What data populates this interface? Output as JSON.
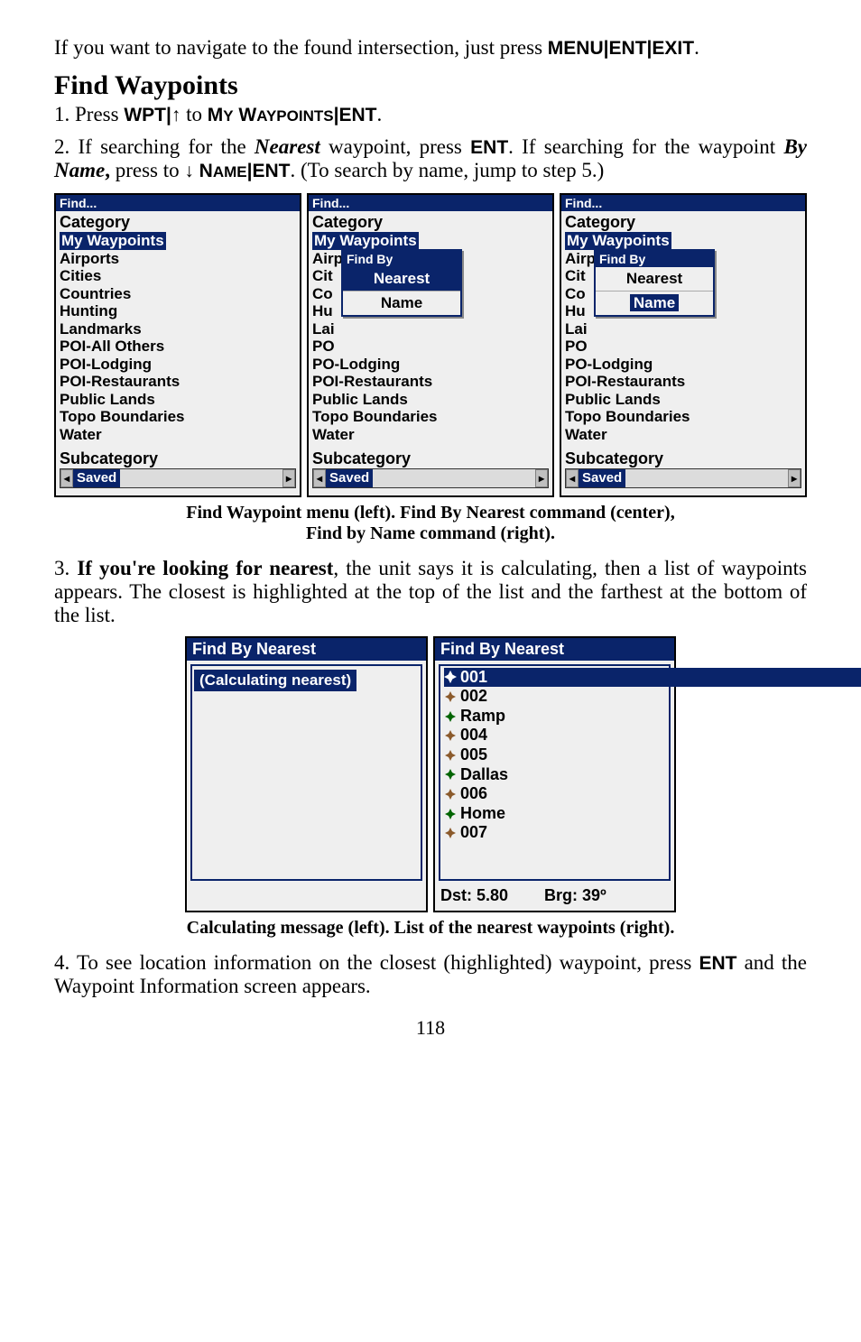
{
  "intro": {
    "text_before": "If you want to navigate to the found intersection, just press ",
    "menu": "MENU",
    "ent": "ENT",
    "exit": "EXIT",
    "period": "."
  },
  "h2": "Find Waypoints",
  "step1": {
    "prefix": "1. Press ",
    "wpt": "WPT",
    "to": " to ",
    "my_w": "M",
    "my_y": "Y",
    "waypoints_w": " W",
    "waypoints_rest": "AYPOINTS",
    "ent": "ENT",
    "period": "."
  },
  "step2": {
    "line_a": "2. If searching for the ",
    "nearest": "Nearest",
    "line_b": " waypoint, press ",
    "ent1": "ENT",
    "line_c": ". If searching for the waypoint ",
    "byname": "By Name",
    "comma": ",",
    "line_d": " press to ",
    "name_n": "N",
    "name_rest": "AME",
    "ent2": "ENT",
    "line_e": ". (To search by name, jump to step 5.)"
  },
  "find_title": "Find...",
  "category_label": "Category",
  "subcategory_label": "Subcategory",
  "saved_label": "Saved",
  "categories": [
    "My Waypoints",
    "Airports",
    "Cities",
    "Countries",
    "Hunting",
    "Landmarks",
    "POI-All Others",
    "POI-Lodging",
    "POI-Restaurants",
    "Public Lands",
    "Topo Boundaries",
    "Water"
  ],
  "cat_trunc": {
    "airports": "Airports",
    "cit": "Cit",
    "co": "Co",
    "hu": "Hu",
    "la": "Lai",
    "po": "PO",
    "pol": "PO-Lodging",
    "por": "POI-Restaurants",
    "pub": "Public Lands",
    "topo": "Topo Boundaries",
    "water": "Water"
  },
  "popup": {
    "title": "Find By",
    "nearest": "Nearest",
    "name": "Name"
  },
  "caption1a": "Find Waypoint menu (left). Find By Nearest command (center),",
  "caption1b": "Find by Name command (right).",
  "step3": {
    "a": "3. ",
    "bold": "If you're looking for nearest",
    "b": ", the unit says it is calculating, then a list of waypoints appears. The closest is highlighted at the top of the list and the farthest at the bottom of the list."
  },
  "findby_title": "Find By Nearest",
  "calc_msg": "(Calculating nearest)",
  "wpts": [
    "001",
    "002",
    "Ramp",
    "004",
    "005",
    "Dallas",
    "006",
    "Home",
    "007"
  ],
  "status": {
    "dst_label": "Dst: ",
    "dst_val": "5.80",
    "brg_label": "Brg: ",
    "brg_val": "39º"
  },
  "caption2": "Calculating message (left). List of the nearest waypoints (right).",
  "step4": {
    "a": "4. To see location information on the closest (highlighted) waypoint, press ",
    "ent": "ENT",
    "b": " and the Waypoint Information screen appears."
  },
  "page": "118"
}
